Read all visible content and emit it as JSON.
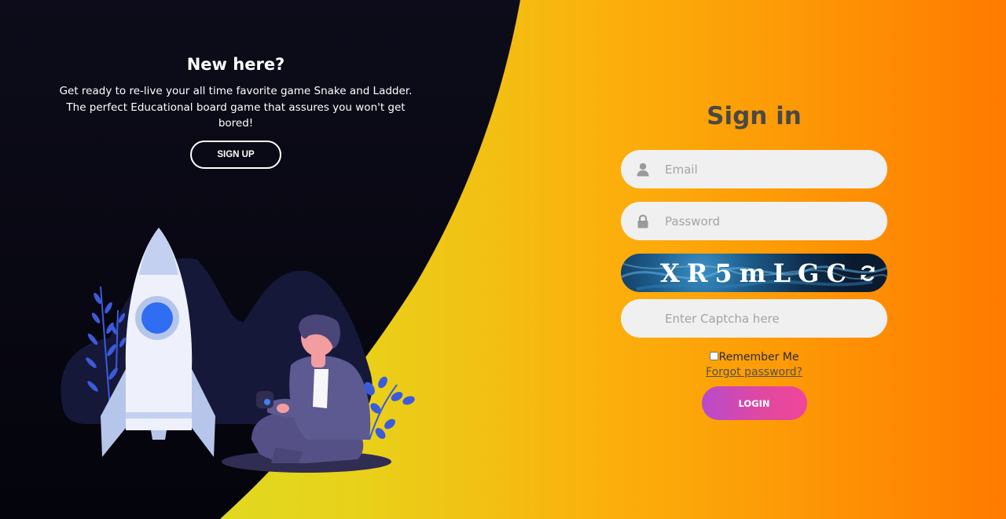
{
  "left": {
    "title": "New here?",
    "description": "Get ready to re-live your all time favorite game Snake and Ladder. The perfect Educational board game that assures you won't get bored!",
    "signup_label": "SIGN UP"
  },
  "right": {
    "title": "Sign in",
    "email_placeholder": "Email",
    "password_placeholder": "Password",
    "captcha_code": "XR5mLGC",
    "captcha_placeholder": "Enter Captcha here",
    "remember_label": "Remember Me",
    "forgot_label": "Forgot password?",
    "login_label": "LOGIN"
  },
  "icons": {
    "email": "user-icon",
    "password": "lock-icon",
    "refresh": "refresh-icon"
  },
  "colors": {
    "dark_panel": "#0a0a18",
    "title_text": "#4a4845",
    "login_gradient_start": "#b94aca",
    "login_gradient_end": "#f0469a",
    "field_bg": "#f0f0f0"
  }
}
